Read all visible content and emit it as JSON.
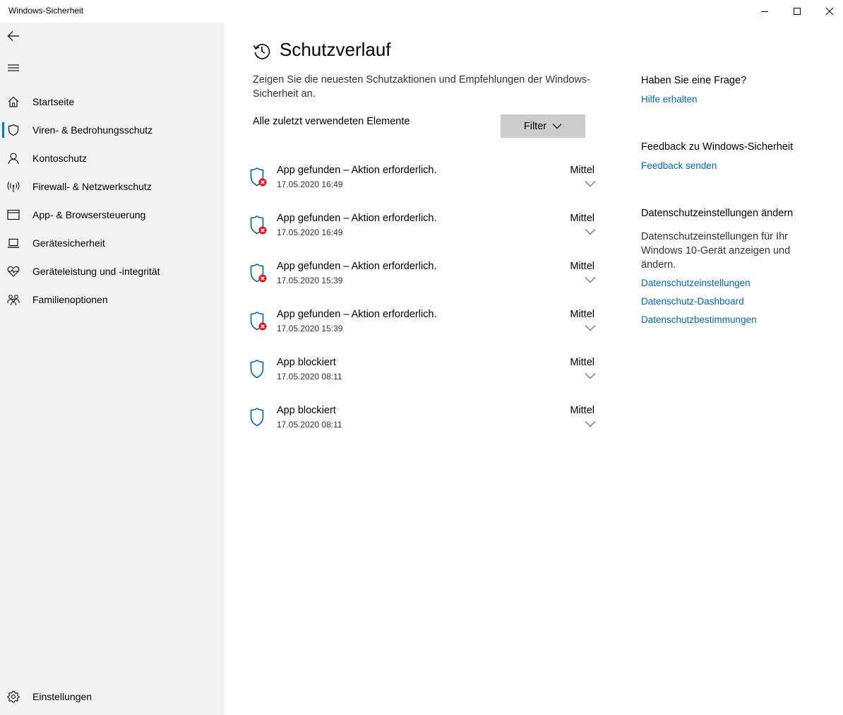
{
  "window": {
    "title": "Windows-Sicherheit"
  },
  "sidebar": {
    "items": [
      {
        "label": "Startseite",
        "icon": "home-icon"
      },
      {
        "label": "Viren- & Bedrohungsschutz",
        "icon": "shield-icon",
        "active": true
      },
      {
        "label": "Kontoschutz",
        "icon": "person-icon"
      },
      {
        "label": "Firewall- & Netzwerkschutz",
        "icon": "antenna-icon"
      },
      {
        "label": "App- & Browsersteuerung",
        "icon": "browser-window-icon"
      },
      {
        "label": "Gerätesicherheit",
        "icon": "laptop-icon"
      },
      {
        "label": "Geräteleistung und -integrität",
        "icon": "heart-pulse-icon"
      },
      {
        "label": "Familienoptionen",
        "icon": "family-icon"
      }
    ],
    "settings_label": "Einstellungen"
  },
  "main": {
    "title": "Schutzverlauf",
    "description": "Zeigen Sie die neuesten Schutzaktionen und Empfehlungen der Windows-Sicherheit an.",
    "subheading": "Alle zuletzt verwendeten Elemente",
    "filter_label": "Filter",
    "entries": [
      {
        "title": "App gefunden – Aktion erforderlich.",
        "date": "17.05.2020 16:49",
        "severity": "Mittel",
        "status": "action-required"
      },
      {
        "title": "App gefunden – Aktion erforderlich.",
        "date": "17.05.2020 16:49",
        "severity": "Mittel",
        "status": "action-required"
      },
      {
        "title": "App gefunden – Aktion erforderlich.",
        "date": "17.05.2020 15:39",
        "severity": "Mittel",
        "status": "action-required"
      },
      {
        "title": "App gefunden – Aktion erforderlich.",
        "date": "17.05.2020 15:39",
        "severity": "Mittel",
        "status": "action-required"
      },
      {
        "title": "App blockiert",
        "date": "17.05.2020 08:11",
        "severity": "Mittel",
        "status": "blocked"
      },
      {
        "title": "App blockiert",
        "date": "17.05.2020 08:11",
        "severity": "Mittel",
        "status": "blocked"
      }
    ]
  },
  "aside": {
    "question_heading": "Haben Sie eine Frage?",
    "help_link": "Hilfe erhalten",
    "feedback_heading": "Feedback zu Windows-Sicherheit",
    "feedback_link": "Feedback senden",
    "privacy_heading": "Datenschutzeinstellungen ändern",
    "privacy_text": "Datenschutzeinstellungen für Ihr Windows 10-Gerät anzeigen und ändern.",
    "privacy_links": [
      "Datenschutzeinstellungen",
      "Datenschutz-Dashboard",
      "Datenschutzbestimmungen"
    ]
  },
  "colors": {
    "accent": "#0078d7",
    "link": "#0067c0",
    "sidebar_bg": "#f2f2f2",
    "warning_red": "#e81123"
  }
}
